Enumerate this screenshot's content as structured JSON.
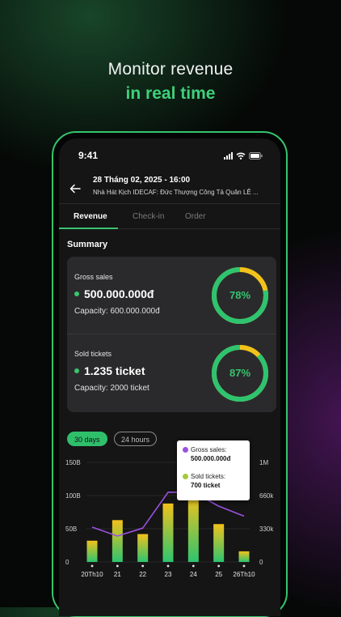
{
  "hero": {
    "title": "Monitor revenue",
    "subtitle": "in real time"
  },
  "status_bar": {
    "time": "9:41"
  },
  "header": {
    "event_title": "28 Tháng 02, 2025 - 16:00",
    "event_venue": "Nhà Hát Kịch IDECAF: Đức Thượng Công Tả Quân LÊ ..."
  },
  "tabs": [
    {
      "label": "Revenue",
      "active": true
    },
    {
      "label": "Check-in",
      "active": false
    },
    {
      "label": "Order",
      "active": false
    }
  ],
  "summary": {
    "label": "Summary",
    "gross": {
      "title": "Gross sales",
      "value": "500.000.000đ",
      "capacity": "Capacity: 600.000.000đ",
      "percent_label": "78%",
      "fraction": 0.78
    },
    "tickets": {
      "title": "Sold tickets",
      "value": "1.235 ticket",
      "capacity": "Capacity: 2000 ticket",
      "percent_label": "87%",
      "fraction": 0.87
    }
  },
  "filters": {
    "days_30": "30 days",
    "hours_24": "24 hours",
    "selected": "30 days"
  },
  "tooltip": {
    "gross_label": "Gross sales:",
    "gross_value": "500.000.000đ",
    "tickets_label": "Sold tickets:",
    "tickets_value": "700 ticket"
  },
  "colors": {
    "accent": "#35c46e",
    "purple": "#9b51e0",
    "bar_top": "#f2c21b",
    "bar_bottom": "#2ec46f",
    "ring_track": "#f2c21b"
  },
  "chart_data": {
    "type": "bar",
    "categories": [
      "20Th10",
      "21",
      "22",
      "23",
      "24",
      "25",
      "26Th10"
    ],
    "series": [
      {
        "name": "Gross sales",
        "type": "bar",
        "axis": "left",
        "values": [
          32,
          63,
          42,
          88,
          100,
          57,
          16
        ]
      },
      {
        "name": "Sold tickets",
        "type": "line",
        "axis": "right",
        "values": [
          350,
          260,
          340,
          700,
          700,
          560,
          460
        ]
      }
    ],
    "y_left": {
      "ticks": [
        "0",
        "50B",
        "100B",
        "150B"
      ],
      "range": [
        0,
        150
      ]
    },
    "y_right": {
      "ticks": [
        "0",
        "330k",
        "660k",
        "1M"
      ],
      "range": [
        0,
        1000
      ]
    },
    "grid": true
  }
}
